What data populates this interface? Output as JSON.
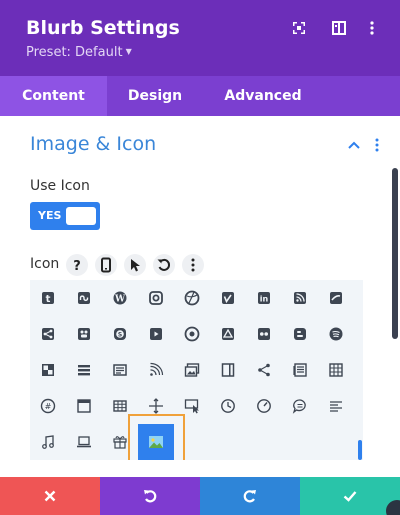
{
  "header": {
    "title": "Blurb Settings",
    "preset": "Preset: Default",
    "icons": [
      "expand-icon",
      "sidebar-toggle-icon",
      "more-vertical-icon"
    ]
  },
  "tabs": [
    {
      "label": "Content",
      "active": true
    },
    {
      "label": "Design",
      "active": false
    },
    {
      "label": "Advanced",
      "active": false
    }
  ],
  "section": {
    "title": "Image & Icon",
    "use_icon_label": "Use Icon",
    "toggle_state": "YES",
    "icon_label": "Icon",
    "icon_tools": [
      "help-icon",
      "mobile-icon",
      "cursor-icon",
      "reset-icon",
      "more-vertical-icon"
    ]
  },
  "icon_grid": {
    "rows": [
      [
        "tumblr",
        "stumbleupon",
        "wordpress",
        "instagram",
        "dribbble",
        "vimeo",
        "linkedin",
        "rss",
        "deviantart"
      ],
      [
        "share",
        "myspace",
        "skype",
        "youtube",
        "picasa",
        "google-drive",
        "flickr",
        "blogger",
        "spotify"
      ],
      [
        "delicious",
        "list",
        "newspaper",
        "rss-alt",
        "images",
        "book",
        "share-alt",
        "news",
        "table"
      ],
      [
        "hashtag",
        "browser",
        "grid",
        "move",
        "cursor-screen",
        "history",
        "speedometer",
        "chat",
        "text-align"
      ],
      [
        "music",
        "laptop",
        "gift",
        "image"
      ]
    ],
    "selected": "image"
  },
  "footer": {
    "buttons": [
      {
        "name": "discard-icon",
        "color": "#ef5555"
      },
      {
        "name": "undo-icon",
        "color": "#7e3bd0"
      },
      {
        "name": "redo-icon",
        "color": "#2e85d8"
      },
      {
        "name": "save-icon",
        "color": "#29c4a9"
      }
    ]
  },
  "colors": {
    "header": "#6c2eb9",
    "tabs": "#7b3fd0",
    "active_tab": "#8e53e4",
    "accent": "#2f80ed",
    "section_title": "#3a86d8",
    "selection_outline": "#f0a13a"
  }
}
